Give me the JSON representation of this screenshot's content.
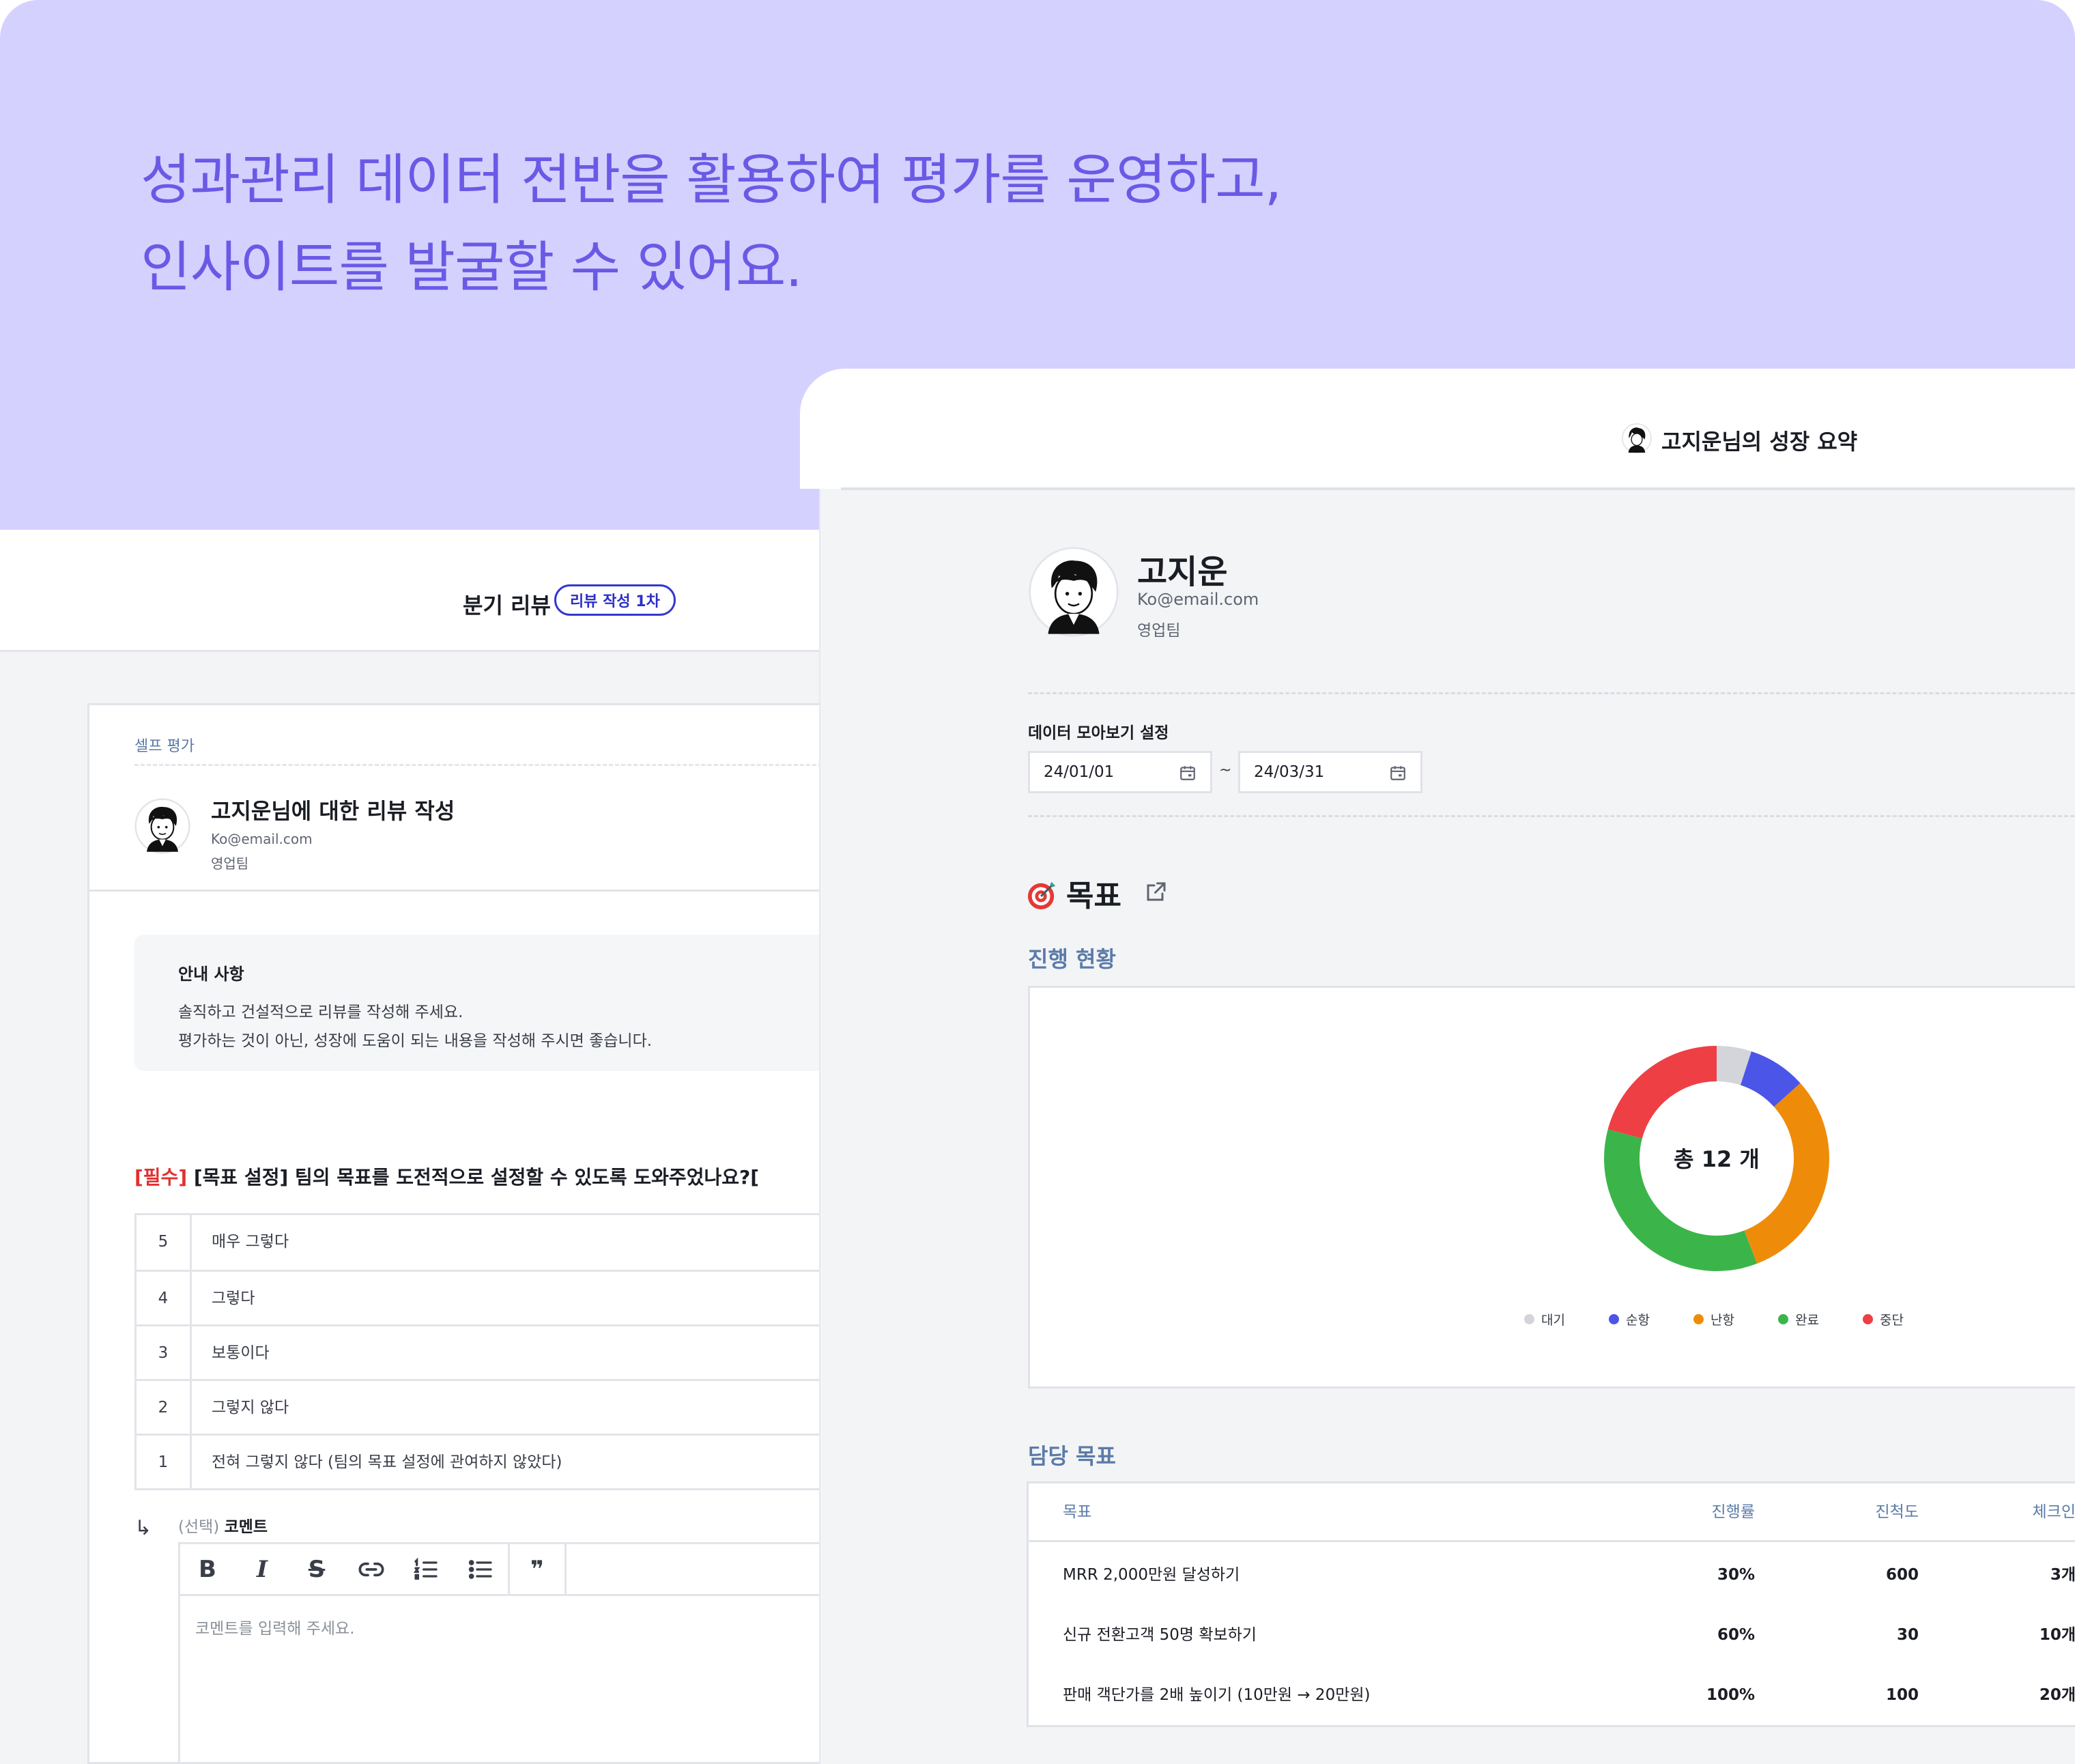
{
  "headline": {
    "line1": "성과관리 데이터 전반을 활용하여 평가를 운영하고,",
    "line2": "인사이트를 발굴할 수 있어요."
  },
  "review": {
    "title": "분기 리뷰",
    "badge": "리뷰 작성 1차",
    "section_label": "셀프 평가",
    "reviewee": {
      "heading": "고지운님에 대한 리뷰 작성",
      "email": "Ko@email.com",
      "team": "영업팀"
    },
    "notice": {
      "title": "안내 사항",
      "line1": "솔직하고 건설적으로 리뷰를 작성해 주세요.",
      "line2": "평가하는 것이 아닌, 성장에 도움이 되는 내용을 작성해 주시면 좋습니다."
    },
    "question": {
      "required_tag": "[필수]",
      "text": " [목표 설정] 팀의 목표를 도전적으로 설정할 수 있도록 도와주었나요?["
    },
    "options": [
      {
        "score": "5",
        "label": "매우 그렇다"
      },
      {
        "score": "4",
        "label": "그렇다"
      },
      {
        "score": "3",
        "label": "보통이다"
      },
      {
        "score": "2",
        "label": "그렇지 않다"
      },
      {
        "score": "1",
        "label": "전혀 그렇지 않다 (팀의 목표 설정에 관여하지 않았다)"
      }
    ],
    "comment": {
      "optional_tag": "(선택)",
      "label": "코멘트",
      "placeholder": "코멘트를 입력해 주세요."
    },
    "toolbar": {
      "bold": "B",
      "italic": "I",
      "strike": "S",
      "link_icon": "link-icon",
      "ordered_list_icon": "ordered-list-icon",
      "bullet_list_icon": "bullet-list-icon",
      "quote": "❞"
    }
  },
  "summary": {
    "header_title": "고지운님의 성장 요약",
    "profile": {
      "name": "고지운",
      "email": "Ko@email.com",
      "team": "영업팀"
    },
    "range": {
      "label": "데이터 모아보기 설정",
      "start": "24/01/01",
      "separator": "~",
      "end": "24/03/31"
    },
    "goal_section": {
      "title": "목표",
      "progress_title": "진행 현황",
      "owned_title": "담당 목표"
    },
    "donut_center": "총 12 개",
    "table": {
      "headers": [
        "목표",
        "진행률",
        "진척도",
        "체크인"
      ],
      "rows": [
        {
          "goal": "MRR 2,000만원 달성하기",
          "progress": "30%",
          "advance": "600",
          "checkin": "3개"
        },
        {
          "goal": "신규 전환고객 50명 확보하기",
          "progress": "60%",
          "advance": "30",
          "checkin": "10개"
        },
        {
          "goal": "판매 객단가를 2배 높이기 (10만원 → 20만원)",
          "progress": "100%",
          "advance": "100",
          "checkin": "20개"
        }
      ]
    }
  },
  "colors": {
    "hero_bg": "#d4d1ff",
    "headline": "#6b59e6",
    "accent": "#3538cd",
    "section": "#5b7ba8"
  },
  "chart_data": {
    "type": "pie",
    "categories": [
      "대기",
      "순항",
      "난항",
      "완료",
      "중단"
    ],
    "values": [
      0.6,
      1.0,
      3.7,
      4.2,
      2.5
    ],
    "colors": [
      "#d3d5da",
      "#4b55e8",
      "#ee8c0a",
      "#3bb54a",
      "#ee3f45"
    ],
    "center_label": "총 12 개",
    "legend": "bottom"
  }
}
